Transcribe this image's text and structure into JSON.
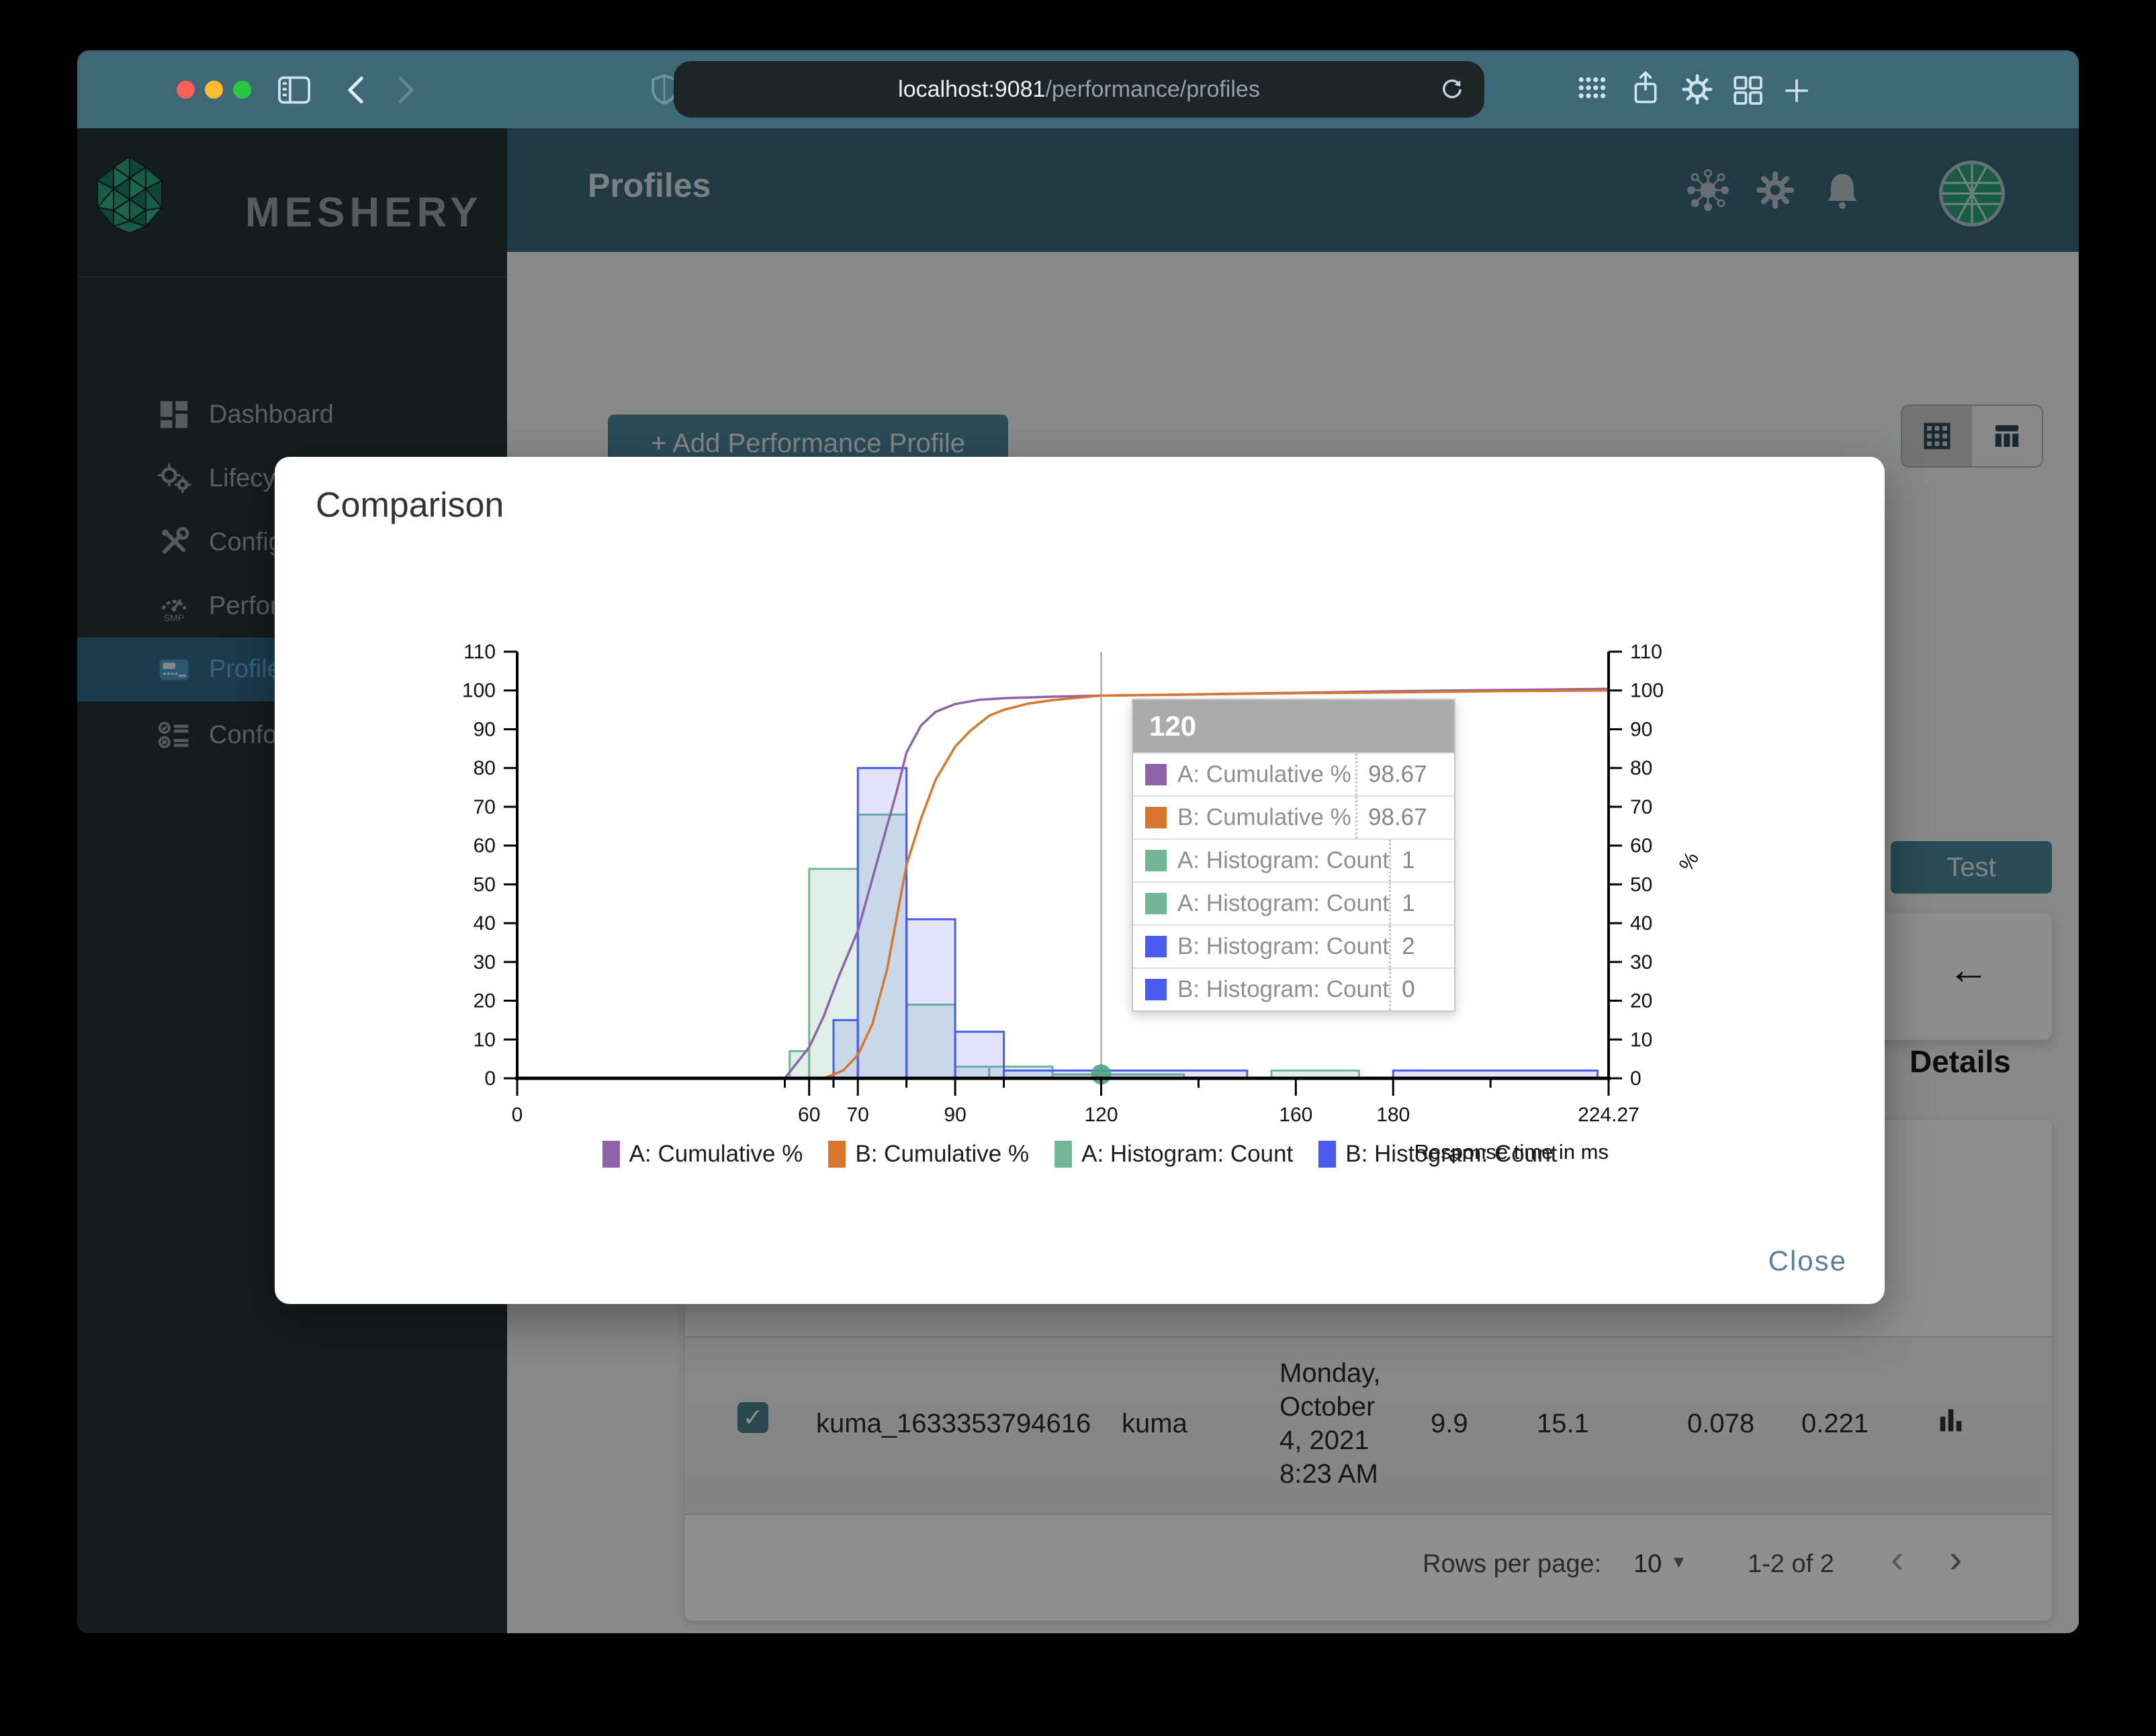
{
  "browser": {
    "url_host": "localhost:9081",
    "url_path": "/performance/profiles"
  },
  "sidebar": {
    "brand": "MESHERY",
    "items": [
      {
        "label": "Dashboard"
      },
      {
        "label": "Lifecycle"
      },
      {
        "label": "Configuration"
      },
      {
        "label": "Performance"
      },
      {
        "label": "Profiles"
      },
      {
        "label": "Conformance"
      }
    ],
    "help_glyph": "?",
    "collapse_glyph": "❮"
  },
  "header": {
    "title": "Profiles"
  },
  "content": {
    "add_button": "+ Add Performance Profile",
    "test_button": "Test",
    "back_arrow": "←",
    "details_heading": "Details"
  },
  "table": {
    "row": {
      "name": "kuma_1633353794616",
      "mesh": "kuma",
      "date_lines": [
        "Monday,",
        "October",
        "4, 2021",
        "8:23 AM"
      ],
      "qps": "9.9",
      "duration": "15.1",
      "p50": "0.078",
      "p99": "0.221"
    }
  },
  "pagination": {
    "rows_per_page_label": "Rows per page:",
    "rows_per_page_value": "10",
    "caret": "▾",
    "range": "1-2 of 2",
    "prev": "‹",
    "next": "›"
  },
  "modal": {
    "title": "Comparison",
    "close_label": "Close",
    "tooltip": {
      "header": "120",
      "rows": [
        {
          "color": "#8E63A9",
          "label": "A: Cumulative %",
          "value": "98.67"
        },
        {
          "color": "#D8772A",
          "label": "B: Cumulative %",
          "value": "98.67"
        },
        {
          "color": "#71B796",
          "label": "A: Histogram: Count",
          "value": "1"
        },
        {
          "color": "#71B796",
          "label": "A: Histogram: Count",
          "value": "1"
        },
        {
          "color": "#4A5CF0",
          "label": "B: Histogram: Count",
          "value": "2"
        },
        {
          "color": "#4A5CF0",
          "label": "B: Histogram: Count",
          "value": "0"
        }
      ]
    },
    "legend": [
      {
        "label": "A: Cumulative %",
        "color": "#8E63A9"
      },
      {
        "label": "B: Cumulative %",
        "color": "#D8772A"
      },
      {
        "label": "A: Histogram: Count",
        "color": "#71B796"
      },
      {
        "label": "B: Histogram: Count",
        "color": "#4A5CF0"
      }
    ]
  },
  "chart_data": {
    "type": "histogram+cumulative-line",
    "title": "Comparison",
    "x_axis": {
      "label": "Response time in ms",
      "min": 0,
      "max": 224.27,
      "major_ticks": [
        0,
        60,
        70,
        90,
        120,
        160,
        180,
        224.27
      ],
      "minor_ticks": [
        55,
        65,
        80,
        100,
        140,
        200
      ]
    },
    "y_axis": {
      "min": 0,
      "max": 110,
      "step": 10,
      "right_label": "%"
    },
    "series": [
      {
        "name": "A: Cumulative %",
        "type": "line",
        "color": "#8E63A9",
        "points": [
          [
            55,
            0
          ],
          [
            60,
            8
          ],
          [
            63,
            16
          ],
          [
            66,
            26
          ],
          [
            70,
            38
          ],
          [
            74,
            56
          ],
          [
            78,
            74
          ],
          [
            80,
            84
          ],
          [
            83,
            91
          ],
          [
            86,
            94.5
          ],
          [
            90,
            96.5
          ],
          [
            95,
            97.6
          ],
          [
            100,
            98
          ],
          [
            110,
            98.4
          ],
          [
            120,
            98.67
          ],
          [
            140,
            99
          ],
          [
            160,
            99.4
          ],
          [
            180,
            99.8
          ],
          [
            200,
            100.1
          ],
          [
            224.27,
            100.4
          ]
        ]
      },
      {
        "name": "B: Cumulative %",
        "type": "line",
        "color": "#D8772A",
        "points": [
          [
            63,
            0
          ],
          [
            67,
            2
          ],
          [
            70,
            6
          ],
          [
            73,
            14
          ],
          [
            76,
            28
          ],
          [
            80,
            55
          ],
          [
            83,
            67
          ],
          [
            86,
            77
          ],
          [
            90,
            85.5
          ],
          [
            93,
            89.5
          ],
          [
            97,
            93.5
          ],
          [
            100,
            95
          ],
          [
            105,
            96.6
          ],
          [
            110,
            97.5
          ],
          [
            120,
            98.67
          ],
          [
            140,
            99
          ],
          [
            160,
            99.3
          ],
          [
            180,
            99.5
          ],
          [
            200,
            99.8
          ],
          [
            224.27,
            100
          ]
        ]
      },
      {
        "name": "A: Histogram: Count",
        "type": "bars",
        "color": "#71B796",
        "fill_opacity": 0.22,
        "bars": [
          [
            56,
            60,
            7
          ],
          [
            60,
            70,
            54
          ],
          [
            70,
            80,
            68
          ],
          [
            80,
            90,
            19
          ],
          [
            90,
            97,
            3
          ],
          [
            97,
            110,
            3
          ],
          [
            110,
            137,
            1
          ],
          [
            155,
            173,
            2
          ]
        ]
      },
      {
        "name": "B: Histogram: Count",
        "type": "bars",
        "color": "#4A5CF0",
        "fill_opacity": 0.16,
        "bars": [
          [
            65,
            70,
            15
          ],
          [
            70,
            80,
            80
          ],
          [
            80,
            90,
            41
          ],
          [
            90,
            100,
            12
          ],
          [
            100,
            150,
            2
          ],
          [
            180,
            222,
            2
          ]
        ]
      }
    ],
    "crosshair_x": 120,
    "marker": {
      "x": 120,
      "y": 1,
      "color": "#4FA183"
    }
  }
}
